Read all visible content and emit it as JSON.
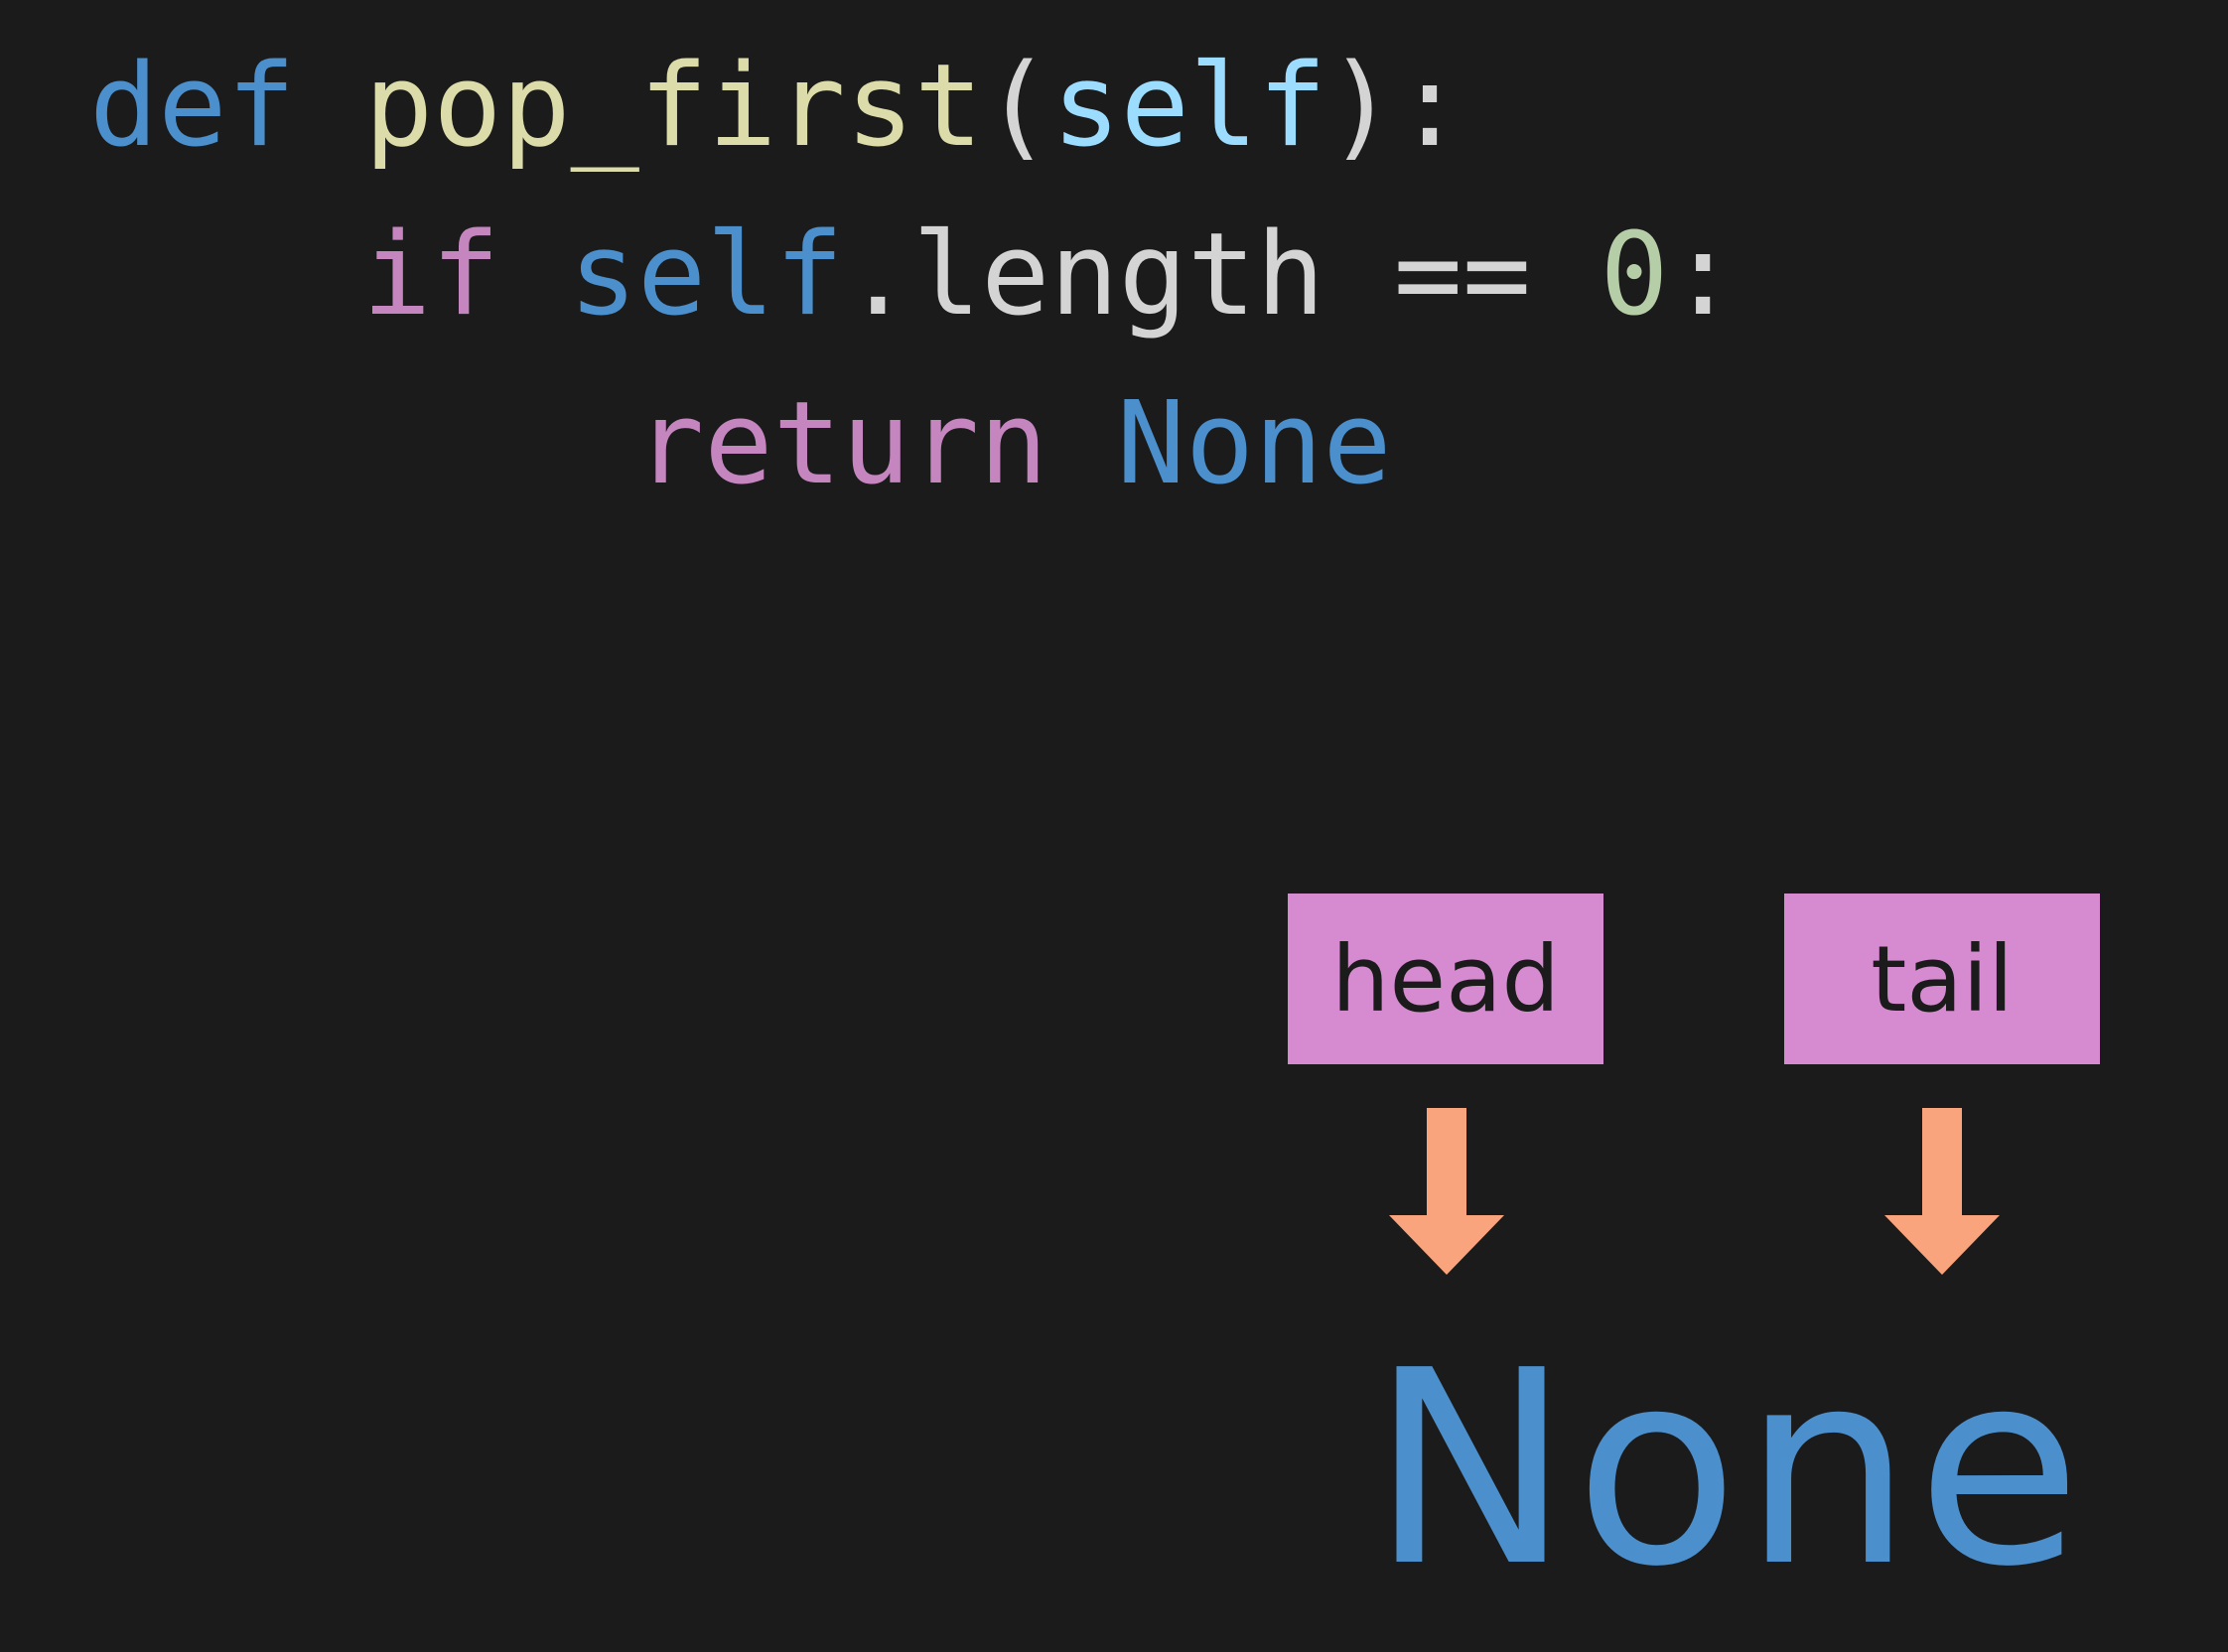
{
  "code": {
    "line1": {
      "kw_def": "def",
      "fn_name": "pop_first",
      "open_paren": "(",
      "param": "self",
      "close_paren_colon": "):"
    },
    "line2": {
      "kw_if": "if",
      "self_ref": "self",
      "attr": ".length",
      "op": "==",
      "number": "0",
      "colon": ":"
    },
    "line3": {
      "kw_return": "return",
      "none_value": "None"
    }
  },
  "diagram": {
    "head_label": "head",
    "tail_label": "tail",
    "target_label": "None"
  },
  "colors": {
    "background": "#1b1b1b",
    "keyword_blue": "#4b8fcc",
    "function_yellow": "#dcdcaa",
    "param_lightblue": "#9cdcfe",
    "control_pink": "#c586c0",
    "number_green": "#b5cea8",
    "text_white": "#d4d4d4",
    "pointer_box": "#d68ad0",
    "arrow": "#f9a47c"
  }
}
